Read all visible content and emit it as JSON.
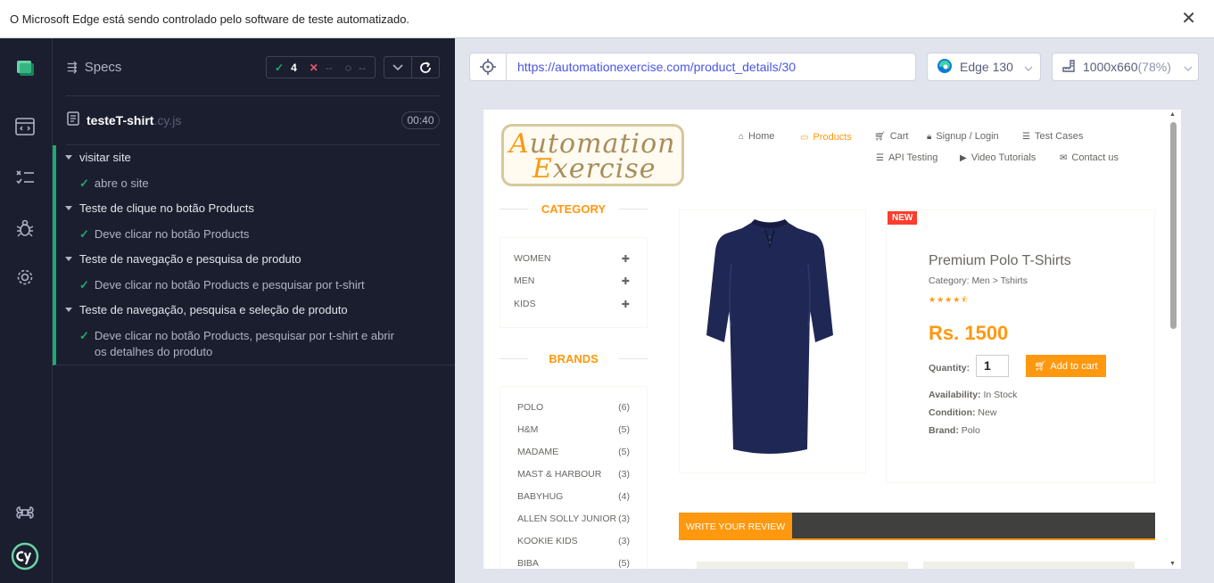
{
  "infobar": {
    "message": "O Microsoft Edge está sendo controlado pelo software de teste automatizado.",
    "close_icon": "close-icon"
  },
  "specs": {
    "title": "Specs",
    "passed": "4",
    "failed": "--",
    "pending": "--",
    "file_name": "testeT-shirt",
    "file_ext": ".cy.js",
    "duration": "00:40",
    "suites": [
      {
        "title": "visitar site",
        "tests": [
          "abre o site"
        ]
      },
      {
        "title": "Teste de clique no botão Products",
        "tests": [
          "Deve clicar no botão Products"
        ]
      },
      {
        "title": "Teste de navegação e pesquisa de produto",
        "tests": [
          "Deve clicar no botão Products e pesquisar por t-shirt"
        ]
      },
      {
        "title": "Teste de navegação, pesquisa e seleção de produto",
        "tests": [
          "Deve clicar no botão Products, pesquisar por t-shirt e abrir os detalhes do produto"
        ]
      }
    ]
  },
  "browser": {
    "url": "https://automationexercise.com/product_details/30",
    "name": "Edge 130",
    "viewport": "1000x660",
    "scale": "(78%)"
  },
  "site": {
    "logo_line1_first": "A",
    "logo_line1_rest": "utomation",
    "logo_line2_first": "E",
    "logo_line2_rest": "xercise",
    "nav": {
      "home": "Home",
      "products": "Products",
      "cart": "Cart",
      "signup": "Signup / Login",
      "test_cases": "Test Cases",
      "api_testing": "API Testing",
      "video_tutorials": "Video Tutorials",
      "contact_us": "Contact us"
    },
    "category_title": "CATEGORY",
    "categories": [
      "WOMEN",
      "MEN",
      "KIDS"
    ],
    "brands_title": "BRANDS",
    "brands": [
      {
        "name": "POLO",
        "count": "(6)"
      },
      {
        "name": "H&M",
        "count": "(5)"
      },
      {
        "name": "MADAME",
        "count": "(5)"
      },
      {
        "name": "MAST & HARBOUR",
        "count": "(3)"
      },
      {
        "name": "BABYHUG",
        "count": "(4)"
      },
      {
        "name": "ALLEN SOLLY JUNIOR",
        "count": "(3)"
      },
      {
        "name": "KOOKIE KIDS",
        "count": "(3)"
      },
      {
        "name": "BIBA",
        "count": "(5)"
      }
    ],
    "product": {
      "badge": "NEW",
      "name": "Premium Polo T-Shirts",
      "category": "Category: Men > Tshirts",
      "rating": 4.5,
      "stars": "★★★★⯪",
      "price": "Rs. 1500",
      "quantity_label": "Quantity:",
      "quantity": "1",
      "add_to_cart": "Add to cart",
      "availability_label": "Availability:",
      "availability": "In Stock",
      "condition_label": "Condition:",
      "condition": "New",
      "brand_label": "Brand:",
      "brand": "Polo"
    },
    "review_tab": "WRITE YOUR REVIEW"
  },
  "colors": {
    "accent": "#fe980f",
    "sidebar_bg": "#1b1e2e",
    "pass": "#1fa971",
    "fail": "#e45770",
    "shirt": "#1f2755"
  }
}
